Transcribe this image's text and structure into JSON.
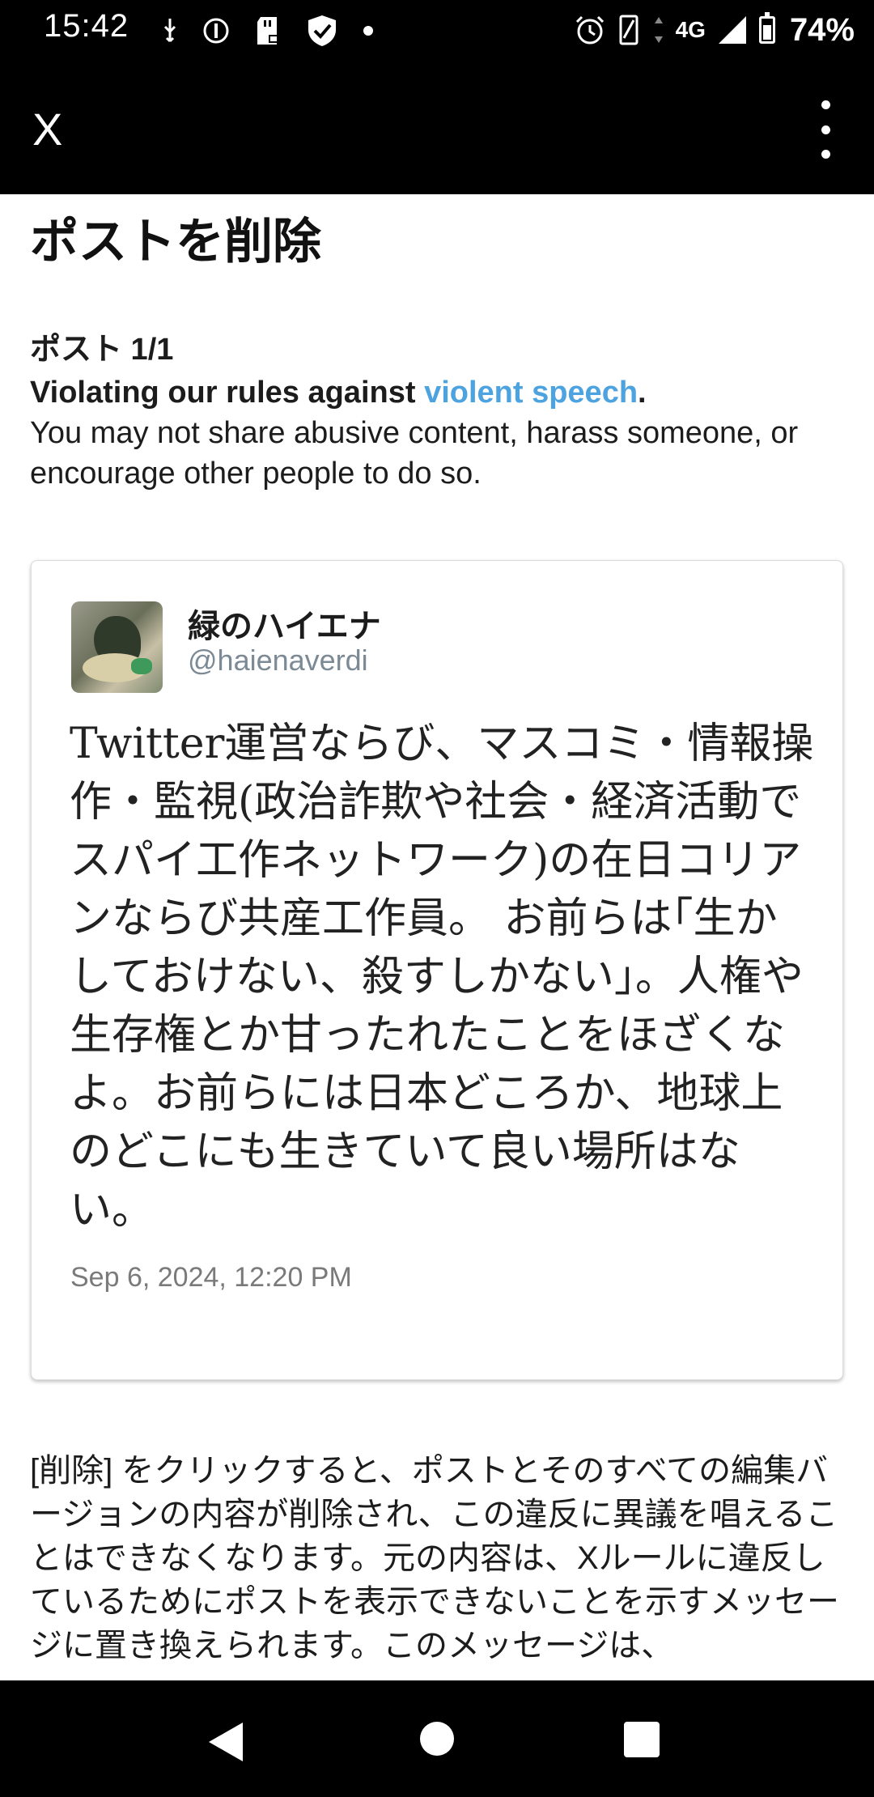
{
  "status_bar": {
    "time": "15:42",
    "network": "4G",
    "battery_percent": "74%",
    "battery_level": 0.74,
    "left_icons": [
      "usb-icon",
      "privacy-icon",
      "sd-card-icon",
      "shield-check-icon",
      "dot-icon"
    ],
    "right_icons": [
      "alarm-icon",
      "vibrate-icon",
      "data-arrows-icon",
      "signal-icon",
      "battery-icon"
    ]
  },
  "app_bar": {
    "close_label": "X"
  },
  "page": {
    "title": "ポストを削除",
    "post_count": "ポスト 1/1",
    "violation_prefix": "Violating our rules against ",
    "violation_link": "violent speech",
    "violation_suffix": ".",
    "violation_detail": "You may not share abusive content, harass someone, or encourage other people to do so."
  },
  "tweet": {
    "display_name": "緑のハイエナ",
    "handle": "@haienaverdi",
    "text": "Twitter運営ならび、マスコミ・情報操作・監視(政治詐欺や社会・経済活動でスパイ工作ネットワーク)の在日コリアンならび共産工作員。 お前らは｢生かしておけない、殺すしかない｣。人権や生存権とか甘ったれたことをほざくなよ。お前らには日本どころか、地球上のどこにも生きていて良い場所はない。",
    "timestamp": "Sep 6, 2024, 12:20 PM"
  },
  "delete_info": "[削除] をクリックすると、ポストとそのすべての編集バージョンの内容が削除され、この違反に異議を唱えることはできなくなります。元の内容は、Xルールに違反しているためにポストを表示できないことを示すメッセージに置き換えられます。このメッセージは、",
  "colors": {
    "link": "#4da3df",
    "bars": "#000000",
    "handle": "#7c8a96"
  }
}
